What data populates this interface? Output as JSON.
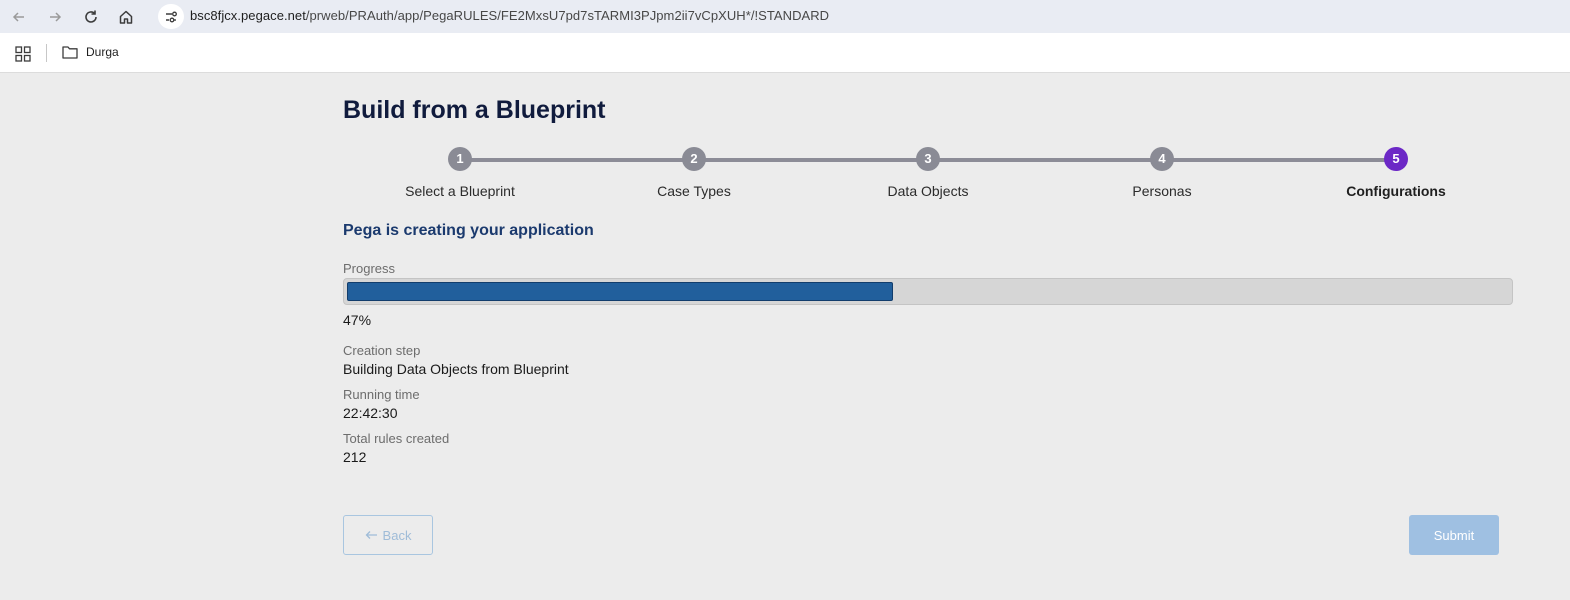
{
  "browser": {
    "url_host": "bsc8fjcx.pegace.net",
    "url_path": "/prweb/PRAuth/app/PegaRULES/FE2MxsU7pd7sTARMI3PJpm2ii7vCpXUH*/!STANDARD",
    "bookmark_folder": "Durga",
    "icons": [
      "back-arrow-icon",
      "forward-arrow-icon",
      "reload-icon",
      "home-icon",
      "site-info-icon",
      "apps-grid-icon",
      "folder-icon"
    ]
  },
  "page": {
    "title": "Build from a Blueprint"
  },
  "stepper": {
    "active_index": 5,
    "steps": [
      {
        "number": "1",
        "label": "Select a Blueprint"
      },
      {
        "number": "2",
        "label": "Case Types"
      },
      {
        "number": "3",
        "label": "Data Objects"
      },
      {
        "number": "4",
        "label": "Personas"
      },
      {
        "number": "5",
        "label": "Configurations"
      }
    ],
    "colors": {
      "inactive": "#8a8b95",
      "active": "#6c28c6"
    }
  },
  "status": {
    "heading": "Pega is creating your application",
    "progress_label": "Progress",
    "progress_fraction": 0.47,
    "progress_text": "47%",
    "creation_step_label": "Creation step",
    "creation_step_value": "Building Data Objects from Blueprint",
    "running_time_label": "Running time",
    "running_time_value": "22:42:30",
    "total_rules_label": "Total rules created",
    "total_rules_value": "212",
    "progress_color": "#215f9c"
  },
  "actions": {
    "back_label": "Back",
    "back_icon": "left-arrow-icon",
    "submit_label": "Submit"
  }
}
